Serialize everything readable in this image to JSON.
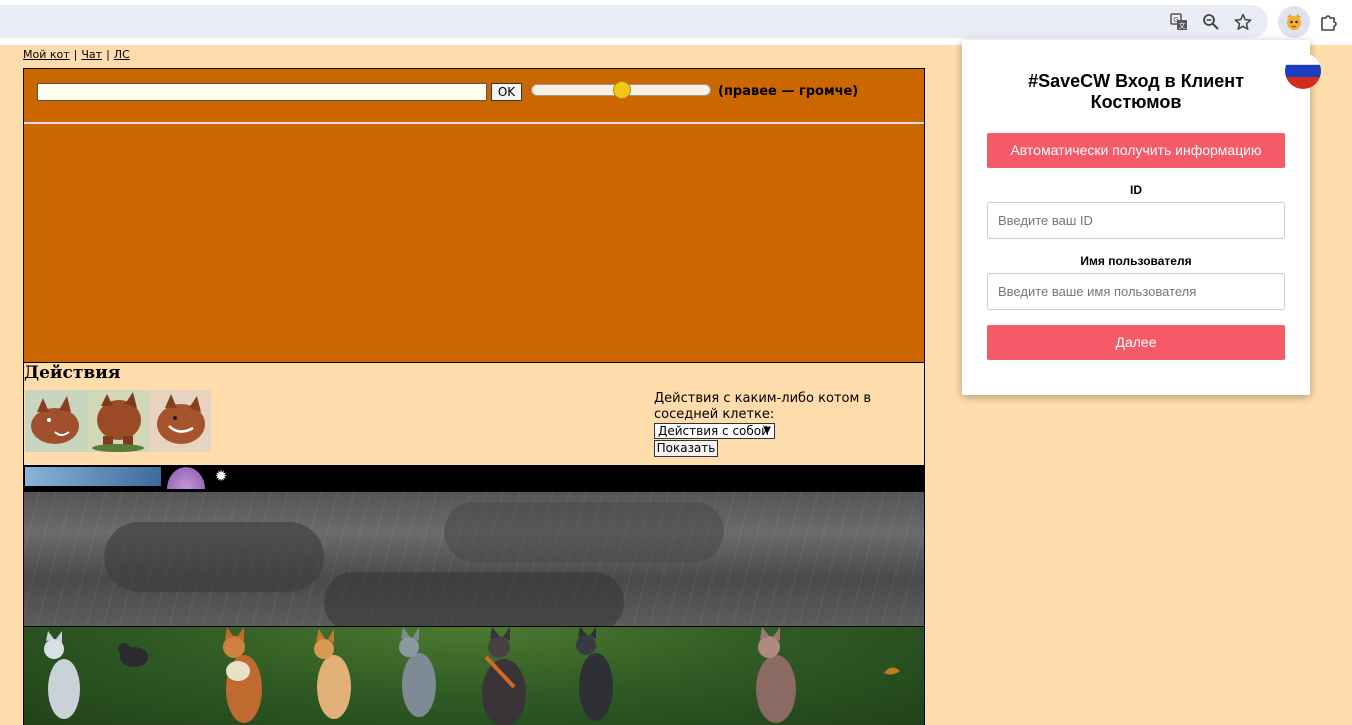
{
  "browser": {
    "translate_icon": "translate-icon",
    "zoom_icon": "zoom-out-icon",
    "bookmark_icon": "star-icon",
    "extension_icon": "cat-extension-icon",
    "extensions_menu_icon": "puzzle-icon"
  },
  "nav": {
    "links": [
      "Мой кот",
      "Чат",
      "ЛС"
    ],
    "separator": "|"
  },
  "chat": {
    "input_value": "",
    "ok_label": "OK",
    "volume_value_percent": 50,
    "volume_label": "(правее — громче)",
    "bg_color": "#cc6600"
  },
  "actions": {
    "title": "Действия",
    "side_text": "Действия с каким-либо котом в соседней клетке:",
    "select_value": "Действия с собой",
    "show_label": "Показать"
  },
  "popup": {
    "title": "#SaveCW Вход в Клиент Костюмов",
    "auto_button": "Автоматически получить информацию",
    "id_label": "ID",
    "id_placeholder": "Введите ваш ID",
    "username_label": "Имя пользователя",
    "username_placeholder": "Введите ваше имя пользователя",
    "next_button": "Далее",
    "accent_color": "#f55a68",
    "language_flag": "russia-flag-icon"
  }
}
